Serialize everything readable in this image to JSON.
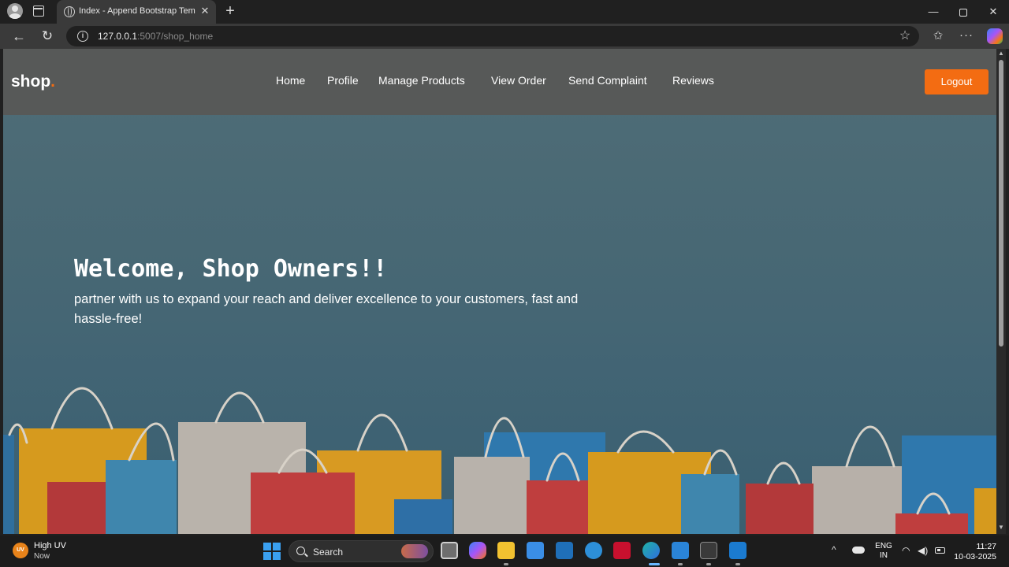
{
  "browser": {
    "tab_title": "Index - Append Bootstrap Templa",
    "tab_close": "✕",
    "new_tab": "+",
    "url_host": "127.0.0.1",
    "url_path": ":5007/shop_home",
    "min": "—",
    "close": "✕"
  },
  "site": {
    "logo": "shop",
    "logo_dot": ".",
    "nav": [
      "Home",
      "Profile",
      "Manage Products",
      "View Order",
      "Send Complaint",
      "Reviews"
    ],
    "logout": "Logout",
    "hero_title": "Welcome, Shop Owners!!",
    "hero_subtitle": "partner with us to expand your reach and deliver excellence to your customers, fast and hassle-free!"
  },
  "taskbar": {
    "weather_badge": "UV",
    "weather_title": "High UV",
    "weather_sub": "Now",
    "search_label": "Search",
    "lang_line1": "ENG",
    "lang_line2": "IN",
    "time": "11:27",
    "date": "10-03-2025"
  },
  "colors": {
    "accent": "#f36c12",
    "navbar": "#585856",
    "hero": "#4a6b76"
  }
}
